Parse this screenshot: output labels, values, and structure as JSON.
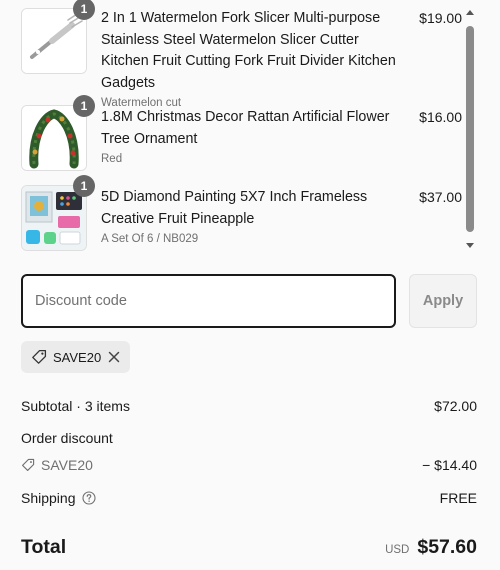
{
  "cart": {
    "items": [
      {
        "title": "2 In 1 Watermelon Fork Slicer Multi-purpose Stainless Steel Watermelon Slicer Cutter Kitchen Fruit Cutting Fork Fruit Divider Kitchen Gadgets",
        "variant": "Watermelon cut",
        "price": "$19.00",
        "quantity": "1",
        "image_icon": "fork-slicer-image"
      },
      {
        "title": "1.8M Christmas Decor Rattan Artificial Flower Tree Ornament",
        "variant": "Red",
        "price": "$16.00",
        "quantity": "1",
        "image_icon": "christmas-garland-image"
      },
      {
        "title": "5D Diamond Painting 5X7 Inch Frameless Creative Fruit Pineapple",
        "variant": "A Set Of 6 / NB029",
        "price": "$37.00",
        "quantity": "1",
        "image_icon": "diamond-painting-image"
      }
    ],
    "scroll_position": 0.05
  },
  "discount": {
    "placeholder": "Discount code",
    "value": "",
    "apply_label": "Apply",
    "applied_code": "SAVE20"
  },
  "summary": {
    "subtotal_label": "Subtotal · 3 items",
    "subtotal_value": "$72.00",
    "order_discount_label": "Order discount",
    "discount_code": "SAVE20",
    "discount_value": "− $14.40",
    "shipping_label": "Shipping",
    "shipping_value": "FREE",
    "total_label": "Total",
    "currency": "USD",
    "total_value": "$57.60"
  },
  "colors": {
    "page_background": "#fafafa",
    "text": "#1a1a1a",
    "muted_text": "#707070",
    "badge": "#666666",
    "input_border_focused": "#1a1a1a",
    "chip_background": "#ebebeb"
  }
}
